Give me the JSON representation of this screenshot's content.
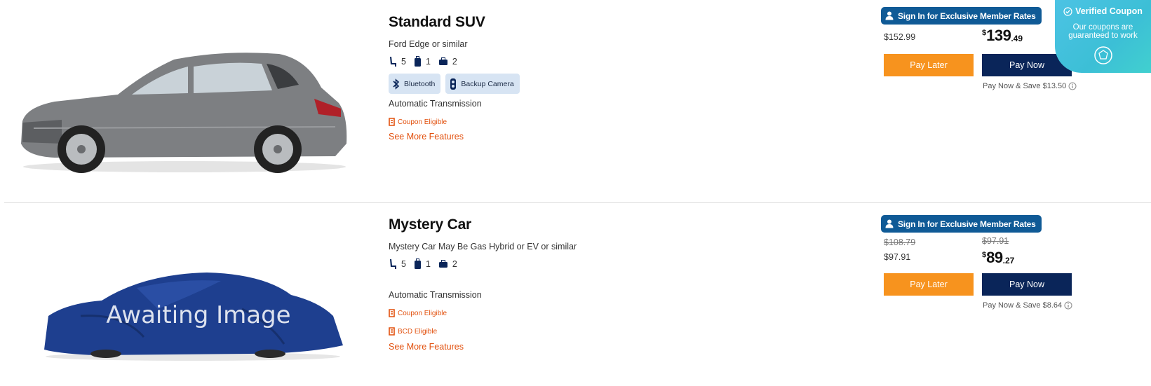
{
  "listings": [
    {
      "name": "Standard SUV",
      "model": "Ford Edge or similar",
      "seats": "5",
      "luggage_large": "1",
      "luggage_small": "2",
      "features": [
        "Bluetooth",
        "Backup Camera"
      ],
      "transmission": "Automatic Transmission",
      "badges": [
        "Coupon Eligible"
      ],
      "see_more": "See More Features",
      "member_rates_label": "Sign In for Exclusive Member Rates",
      "pay_later_price": "$152.99",
      "pay_now_currency": "$",
      "pay_now_whole": "139",
      "pay_now_cents": ".49",
      "pay_later_label": "Pay Later",
      "pay_now_label": "Pay Now",
      "save_text": "Pay Now & Save $13.50",
      "image_color": "#7b7d80"
    },
    {
      "name": "Mystery Car",
      "model": "Mystery Car May Be Gas Hybrid or EV or similar",
      "seats": "5",
      "luggage_large": "1",
      "luggage_small": "2",
      "transmission": "Automatic Transmission",
      "badges": [
        "Coupon Eligible",
        "BCD Eligible"
      ],
      "see_more": "See More Features",
      "member_rates_label": "Sign In for Exclusive Member Rates",
      "pay_later_original": "$108.79",
      "pay_later_price": "$97.91",
      "pay_now_original": "$97.91",
      "pay_now_currency": "$",
      "pay_now_whole": "89",
      "pay_now_cents": ".27",
      "pay_later_label": "Pay Later",
      "pay_now_label": "Pay Now",
      "save_text": "Pay Now & Save $8.64",
      "image_overlay_text": "Awaiting Image",
      "image_color": "#1e3f8f"
    }
  ],
  "coupon": {
    "title": "Verified Coupon",
    "text": "Our coupons are guaranteed to work"
  },
  "colors": {
    "orange": "#f7931e",
    "navy": "#0a2559",
    "member_blue": "#0f5a96",
    "link_orange": "#e2500d",
    "chip_bg": "#d7e4f3",
    "coupon_teal": "#4cc3e4"
  }
}
